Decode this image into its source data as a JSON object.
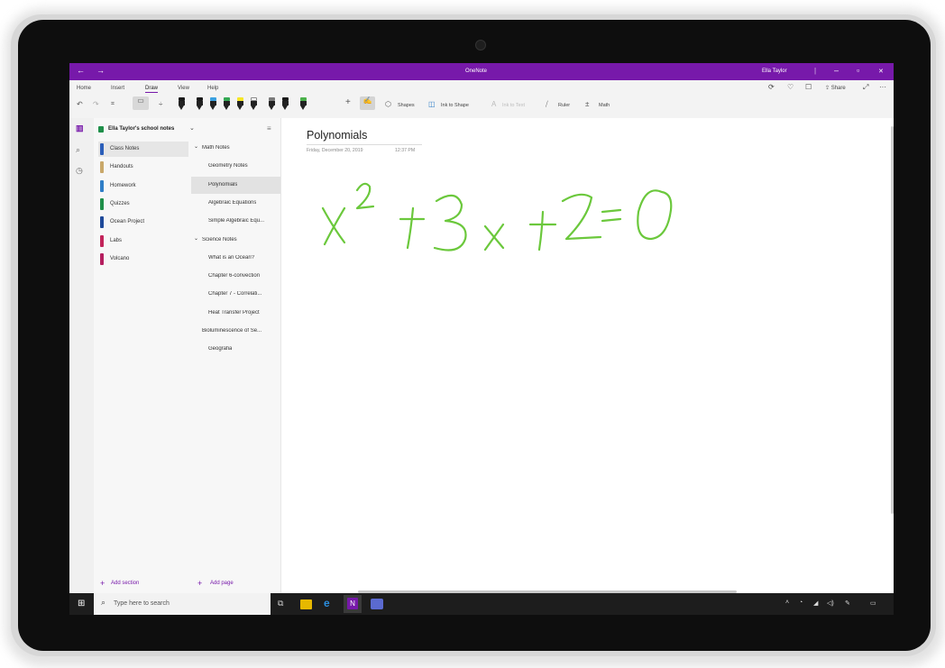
{
  "titlebar": {
    "app_title": "OneNote",
    "user_name": "Ella Taylor",
    "back_glyph": "←",
    "forward_glyph": "→",
    "minimize_glyph": "–",
    "restore_glyph": "▫",
    "close_glyph": "✕",
    "color": "#7719aa"
  },
  "ribbon": {
    "tabs": [
      "Home",
      "Insert",
      "Draw",
      "View",
      "Help"
    ],
    "active_tab": "Draw",
    "share_label": "Share",
    "more_glyph": "···",
    "tools": {
      "shapes": "Shapes",
      "ink_to_shape": "Ink to Shape",
      "ink_to_text": "Ink to Text",
      "ruler": "Ruler",
      "math": "Math"
    },
    "pen_colors": [
      "#1a1a1a",
      "#1a1a1a",
      "#3aa0e0",
      "#34a853",
      "#f5e625",
      "#ffffff",
      "#7a7a7a",
      "#1a1a1a",
      "#4ab04a"
    ]
  },
  "notebook": {
    "name": "Ella Taylor's school notes",
    "sections": [
      {
        "label": "Class Notes",
        "color": "#2b5eb9"
      },
      {
        "label": "Handouts",
        "color": "#c9a86a"
      },
      {
        "label": "Homework",
        "color": "#2f7ec7"
      },
      {
        "label": "Quizzes",
        "color": "#1f8f4a"
      },
      {
        "label": "Ocean Project",
        "color": "#1f4a9a"
      },
      {
        "label": "Labs",
        "color": "#c2245a"
      },
      {
        "label": "Volcano",
        "color": "#b51f5f"
      }
    ],
    "add_section": "Add section"
  },
  "pages": {
    "groups": [
      {
        "label": "Math Notes",
        "items": [
          "Geometry Notes",
          "Polynomials",
          "Algebraic Equations",
          "Simple Algebraic Equ..."
        ]
      },
      {
        "label": "Science Notes",
        "items": [
          "What is an Ocean?",
          "Chapter 6-convection",
          "Chapter 7 - Correlati...",
          "Heat Transfer Project"
        ]
      }
    ],
    "extra": [
      "Bioluminescence of Se...",
      "Geografia"
    ],
    "selected": "Polynomials",
    "add_page": "Add page"
  },
  "page": {
    "title": "Polynomials",
    "date": "Friday, December 20, 2019",
    "time": "12:37 PM",
    "ink_color": "#6bc83c"
  },
  "taskbar": {
    "search_placeholder": "Type here to search"
  }
}
